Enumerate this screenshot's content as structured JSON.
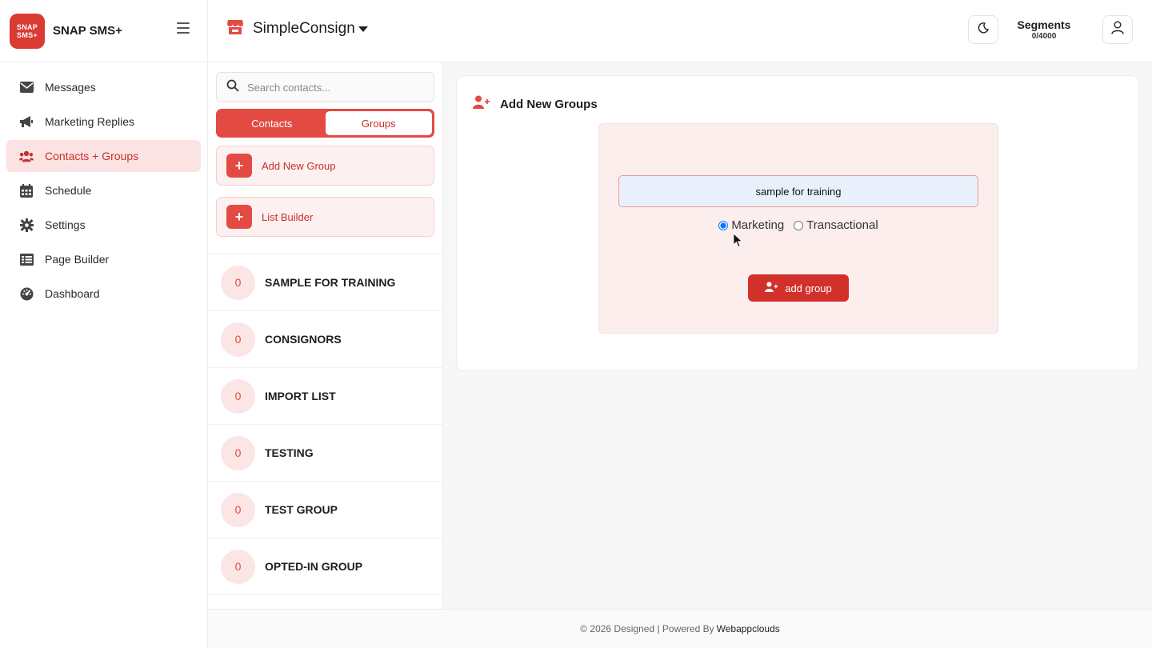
{
  "brand": {
    "logo_line1": "SNAP",
    "logo_line2": "SMS+",
    "name": "SNAP SMS+"
  },
  "sidebar": {
    "items": [
      {
        "label": "Messages",
        "icon": "envelope-icon",
        "active": false
      },
      {
        "label": "Marketing Replies",
        "icon": "megaphone-icon",
        "active": false
      },
      {
        "label": "Contacts + Groups",
        "icon": "users-icon",
        "active": true
      },
      {
        "label": "Schedule",
        "icon": "calendar-icon",
        "active": false
      },
      {
        "label": "Settings",
        "icon": "gear-icon",
        "active": false
      },
      {
        "label": "Page Builder",
        "icon": "list-icon",
        "active": false
      },
      {
        "label": "Dashboard",
        "icon": "gauge-icon",
        "active": false
      }
    ]
  },
  "topbar": {
    "store_name": "SimpleConsign",
    "segments_label": "Segments",
    "segments_value": "0/4000"
  },
  "contacts_panel": {
    "search_placeholder": "Search contacts...",
    "tab_contacts": "Contacts",
    "tab_groups": "Groups",
    "add_new_group": "Add New Group",
    "list_builder": "List Builder",
    "groups": [
      {
        "count": "0",
        "name": "SAMPLE FOR TRAINING"
      },
      {
        "count": "0",
        "name": "CONSIGNORS"
      },
      {
        "count": "0",
        "name": "IMPORT LIST"
      },
      {
        "count": "0",
        "name": "TESTING"
      },
      {
        "count": "0",
        "name": "TEST GROUP"
      },
      {
        "count": "0",
        "name": "OPTED-IN GROUP"
      }
    ]
  },
  "add_group_form": {
    "title": "Add New Groups",
    "group_name_value": "sample for training",
    "radio_marketing": "Marketing",
    "radio_transactional": "Transactional",
    "selected_type": "Marketing",
    "submit_label": "add group"
  },
  "footer": {
    "text": "© 2026 Designed | Powered By",
    "link": "Webappclouds"
  },
  "colors": {
    "accent": "#e34a43",
    "accent_dark": "#d1302b",
    "active_bg": "#fbe3e3"
  }
}
